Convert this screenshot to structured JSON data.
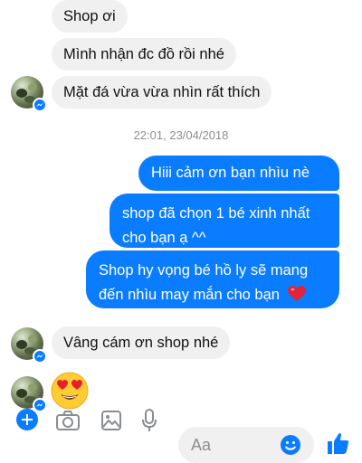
{
  "conversation": {
    "messages_top": [
      {
        "text": "Shop ơi"
      },
      {
        "text": "Mình nhận đc đồ rồi nhé"
      },
      {
        "text": "Mặt đá vừa vừa nhìn rất thích"
      }
    ],
    "timestamp": "22:01, 23/04/2018",
    "messages_sent": [
      {
        "text": "Hiii cảm ơn bạn  nhìu nè"
      },
      {
        "line1": "shop đã chọn 1 bé xinh nhất",
        "line2": "cho bạn ạ ^^"
      },
      {
        "line1": "Shop hy vọng bé hồ ly sẽ mang",
        "line2": "đến nhìu may mắn cho bạn",
        "emoji": "red-heart"
      }
    ],
    "reply": {
      "text": "Vâng cám ơn shop nhé"
    },
    "reaction_emoji": "heart-eyes-emoji"
  },
  "composer": {
    "placeholder": "Aa"
  },
  "colors": {
    "sent_bubble": "#0a7cff",
    "received_bubble": "#f0f0f0",
    "accent": "#0a7cff"
  }
}
